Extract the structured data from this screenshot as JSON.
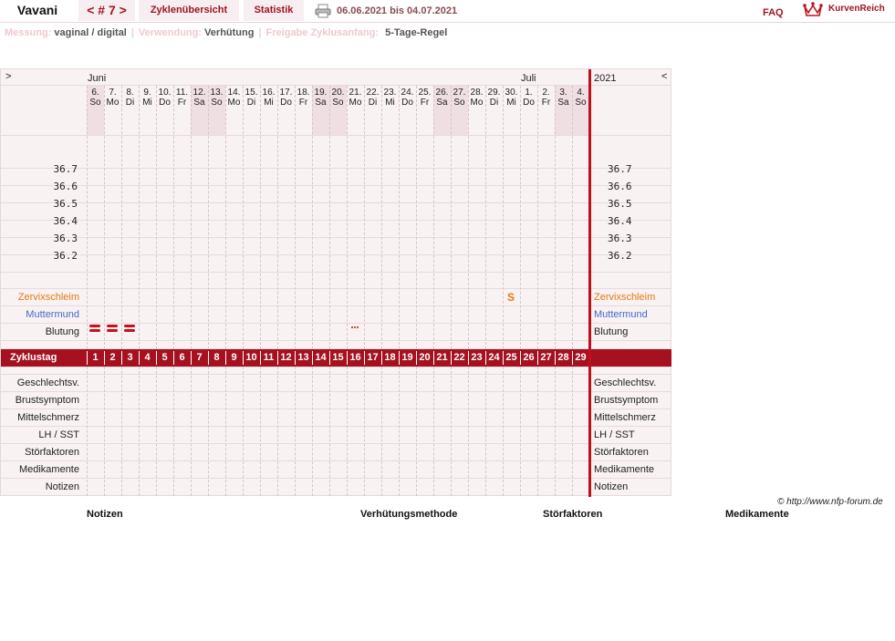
{
  "header": {
    "app_title": "Vavani",
    "cycle_nav": "< # 7 >",
    "tab_overview": "Zyklenübersicht",
    "tab_stats": "Statistik",
    "date_range": "06.06.2021 bis 04.07.2021",
    "faq": "FAQ",
    "logo_text": "KurvenReich"
  },
  "settings": {
    "measure_label": "Messung:",
    "measure_value": "vaginal / digital",
    "use_label": "Verwendung:",
    "use_value": "Verhütung",
    "release_label": "Freigabe Zyklusanfang:",
    "release_value": "5-Tage-Regel"
  },
  "chart": {
    "nav_prev": ">",
    "nav_next": "<",
    "month_june": "Juni",
    "month_july": "Juli",
    "year": "2021",
    "days": [
      {
        "num": "6.",
        "wd": "So",
        "we": true
      },
      {
        "num": "7.",
        "wd": "Mo",
        "we": false
      },
      {
        "num": "8.",
        "wd": "Di",
        "we": false
      },
      {
        "num": "9.",
        "wd": "Mi",
        "we": false
      },
      {
        "num": "10.",
        "wd": "Do",
        "we": false
      },
      {
        "num": "11.",
        "wd": "Fr",
        "we": false
      },
      {
        "num": "12.",
        "wd": "Sa",
        "we": true
      },
      {
        "num": "13.",
        "wd": "So",
        "we": true
      },
      {
        "num": "14.",
        "wd": "Mo",
        "we": false
      },
      {
        "num": "15.",
        "wd": "Di",
        "we": false
      },
      {
        "num": "16.",
        "wd": "Mi",
        "we": false
      },
      {
        "num": "17.",
        "wd": "Do",
        "we": false
      },
      {
        "num": "18.",
        "wd": "Fr",
        "we": false
      },
      {
        "num": "19.",
        "wd": "Sa",
        "we": true
      },
      {
        "num": "20.",
        "wd": "So",
        "we": true
      },
      {
        "num": "21.",
        "wd": "Mo",
        "we": false
      },
      {
        "num": "22.",
        "wd": "Di",
        "we": false
      },
      {
        "num": "23.",
        "wd": "Mi",
        "we": false
      },
      {
        "num": "24.",
        "wd": "Do",
        "we": false
      },
      {
        "num": "25.",
        "wd": "Fr",
        "we": false
      },
      {
        "num": "26.",
        "wd": "Sa",
        "we": true
      },
      {
        "num": "27.",
        "wd": "So",
        "we": true
      },
      {
        "num": "28.",
        "wd": "Mo",
        "we": false
      },
      {
        "num": "29.",
        "wd": "Di",
        "we": false
      },
      {
        "num": "30.",
        "wd": "Mi",
        "we": false
      },
      {
        "num": "1.",
        "wd": "Do",
        "we": false
      },
      {
        "num": "2.",
        "wd": "Fr",
        "we": false
      },
      {
        "num": "3.",
        "wd": "Sa",
        "we": true
      },
      {
        "num": "4.",
        "wd": "So",
        "we": true
      }
    ],
    "temps": [
      "36.7",
      "36.6",
      "36.5",
      "36.4",
      "36.3",
      "36.2"
    ],
    "rows_top": [
      {
        "label": "Zervixschleim",
        "color": "#e87810"
      },
      {
        "label": "Muttermund",
        "color": "#4a68c8"
      },
      {
        "label": "Blutung",
        "color": "#222222"
      }
    ],
    "zyklus_label": "Zyklustag",
    "rows_bottom": [
      "Geschlechtsv.",
      "Brustsymptom",
      "Mittelschmerz",
      "LH / SST",
      "Störfaktoren",
      "Medikamente",
      "Notizen"
    ],
    "cervix_mark": {
      "day_index": 24,
      "symbol": "S"
    },
    "bleeding_days": [
      0,
      1,
      2
    ],
    "spotting_days": [
      15
    ]
  },
  "footer": {
    "credit": "© http://www.nfp-forum.de",
    "notes": "Notizen",
    "method": "Verhütungsmethode",
    "disturbances": "Störfaktoren",
    "medication": "Medikamente"
  },
  "colors": {
    "accent": "#a5111f",
    "cervix": "#e87810",
    "cervix_os": "#4a68c8"
  }
}
